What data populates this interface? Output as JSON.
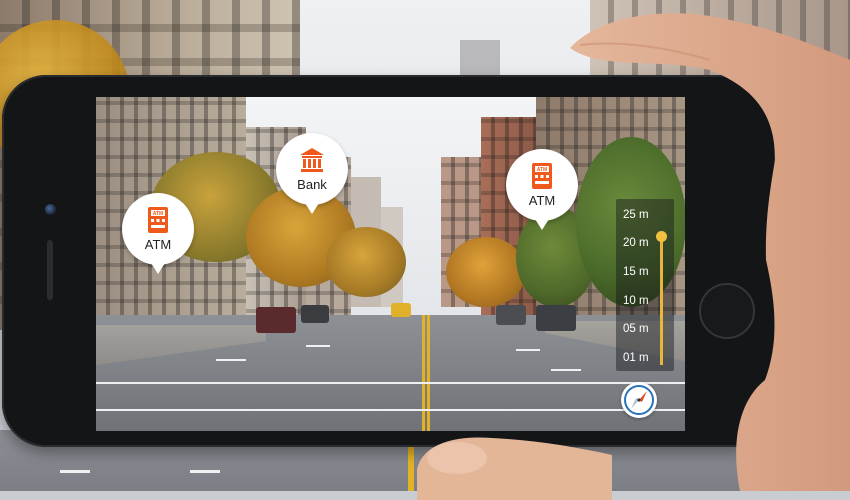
{
  "pins": [
    {
      "label": "ATM",
      "icon": "atm-icon"
    },
    {
      "label": "Bank",
      "icon": "bank-icon"
    },
    {
      "label": "ATM",
      "icon": "atm-icon"
    }
  ],
  "scale": {
    "ticks": [
      "25 m",
      "20 m",
      "15 m",
      "10 m",
      "05 m",
      "01 m"
    ],
    "selected": "20 m"
  },
  "compass": {
    "icon": "compass-icon"
  },
  "colors": {
    "pin_icon": "#f0591c",
    "scale_track": "#e9b53a",
    "compass_needle": "#e34b2e",
    "compass_ring": "#2a73b8"
  }
}
